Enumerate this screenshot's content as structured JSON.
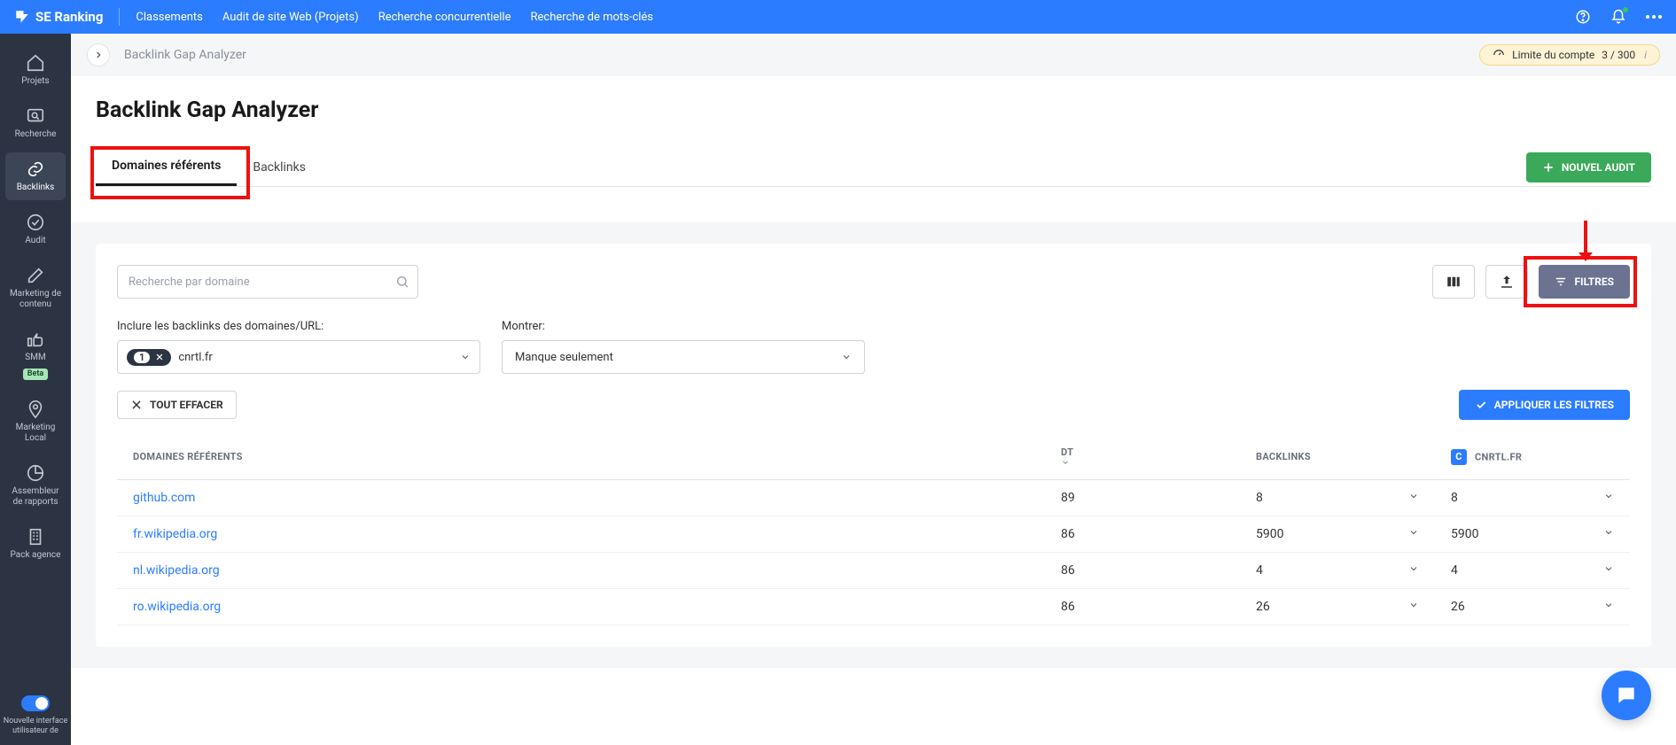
{
  "topbar": {
    "brand": "SE Ranking",
    "nav": {
      "rankings": "Classements",
      "audit": "Audit de site Web (Projets)",
      "competitive": "Recherche concurrentielle",
      "keyword": "Recherche de mots-clés"
    }
  },
  "sidebar": {
    "projects": "Projets",
    "search": "Recherche",
    "backlinks": "Backlinks",
    "audit": "Audit",
    "content_marketing": "Marketing de contenu",
    "smm": "SMM",
    "smm_badge": "Beta",
    "local_marketing": "Marketing Local",
    "report_builder": "Assembleur de rapports",
    "agency_pack": "Pack agence",
    "new_ui_toggle": "Nouvelle interface utilisateur de"
  },
  "breadcrumb": "Backlink Gap Analyzer",
  "account_limit": {
    "label": "Limite du compte",
    "value": "3 / 300"
  },
  "page_title": "Backlink Gap Analyzer",
  "tabs": {
    "referring_domains": "Domaines référents",
    "backlinks": "Backlinks"
  },
  "new_audit_btn": "NOUVEL AUDIT",
  "search_placeholder": "Recherche par domaine",
  "filters_btn": "FILTRES",
  "include_label": "Inclure les backlinks des domaines/URL:",
  "show_label": "Montrer:",
  "chip": {
    "num": "1",
    "domain": "cnrtl.fr"
  },
  "show_value": "Manque seulement",
  "clear_all": "TOUT EFFACER",
  "apply_filters": "APPLIQUER LES FILTRES",
  "table": {
    "headers": {
      "referring_domains": "DOMAINES RÉFÉRENTS",
      "dt": "DT",
      "backlinks": "BACKLINKS",
      "domain_col": "CNRTL.FR"
    },
    "rows": [
      {
        "domain": "github.com",
        "dt": "89",
        "backlinks": "8",
        "own": "8"
      },
      {
        "domain": "fr.wikipedia.org",
        "dt": "86",
        "backlinks": "5900",
        "own": "5900"
      },
      {
        "domain": "nl.wikipedia.org",
        "dt": "86",
        "backlinks": "4",
        "own": "4"
      },
      {
        "domain": "ro.wikipedia.org",
        "dt": "86",
        "backlinks": "26",
        "own": "26"
      }
    ]
  }
}
